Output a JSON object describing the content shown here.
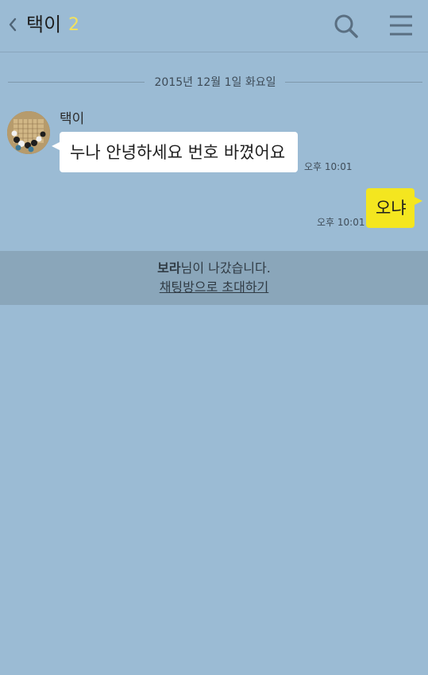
{
  "header": {
    "back_icon": "chevron-left-icon",
    "title": "택이",
    "member_count": "2",
    "search_icon": "search-icon",
    "menu_icon": "hamburger-menu-icon"
  },
  "date_divider": {
    "text": "2015년 12월 1일 화요일"
  },
  "messages": [
    {
      "sender": "택이",
      "text": "누나 안녕하세요 번호 바꼈어요",
      "time": "오후 10:01",
      "direction": "incoming"
    },
    {
      "text": "오냐",
      "time": "오후 10:01",
      "direction": "outgoing"
    }
  ],
  "system_notice": {
    "name": "보라",
    "suffix": "님이 나갔습니다.",
    "invite_link": "채팅방으로 초대하기"
  },
  "colors": {
    "background": "#9bbbd4",
    "incoming_bubble": "#ffffff",
    "outgoing_bubble": "#f4e61f",
    "member_count": "#f3e25c"
  }
}
